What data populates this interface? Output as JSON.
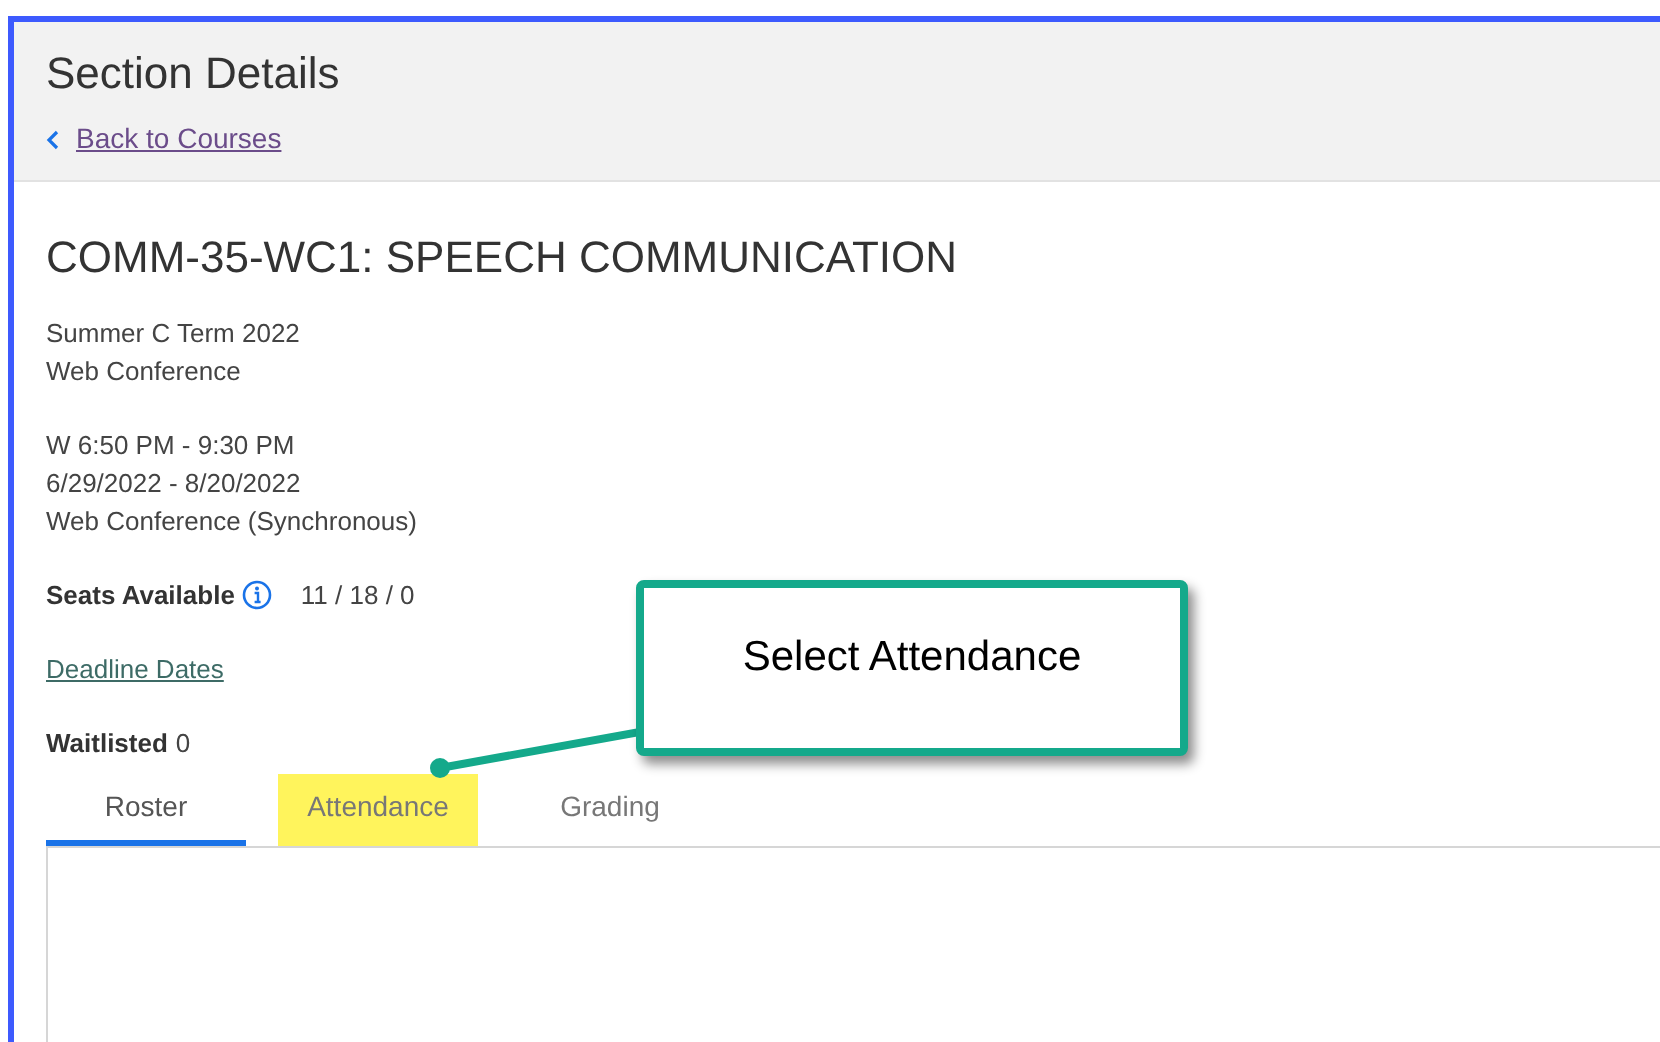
{
  "header": {
    "title": "Section Details",
    "back_link": "Back to Courses"
  },
  "section": {
    "title": "COMM-35-WC1: SPEECH COMMUNICATION",
    "term": "Summer C Term 2022",
    "delivery": "Web Conference",
    "schedule": [
      "W 6:50 PM - 9:30 PM",
      "6/29/2022 - 8/20/2022",
      "Web Conference (Synchronous)"
    ],
    "seats_label": "Seats Available",
    "seats_value": "11 / 18 / 0",
    "deadline_link": "Deadline Dates",
    "waitlisted_label": "Waitlisted",
    "waitlisted_value": "0"
  },
  "tabs": [
    {
      "label": "Roster",
      "selected": true,
      "highlighted": false
    },
    {
      "label": "Attendance",
      "selected": false,
      "highlighted": true
    },
    {
      "label": "Grading",
      "selected": false,
      "highlighted": false
    }
  ],
  "callout": {
    "text": "Select Attendance"
  }
}
